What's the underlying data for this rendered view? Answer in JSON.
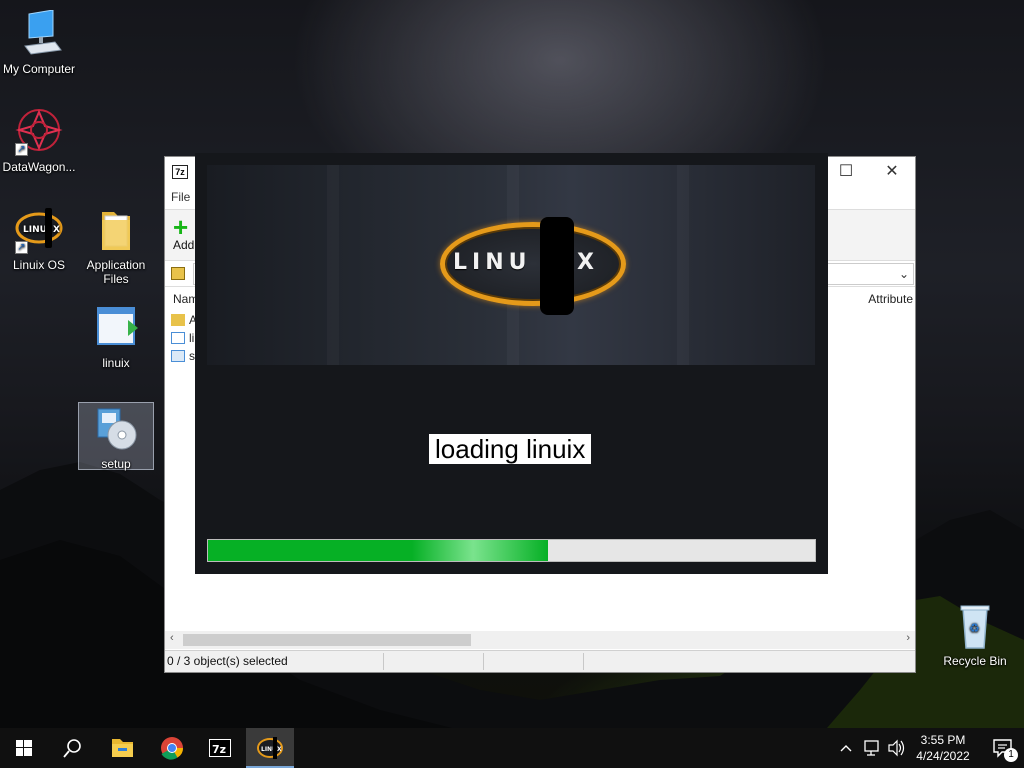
{
  "desktop": {
    "icons": [
      {
        "label": "My Computer",
        "icon": "computer-icon"
      },
      {
        "label": "DataWagon...",
        "icon": "datawagon-icon"
      },
      {
        "label": "Linuix OS",
        "icon": "linuix-os-icon"
      },
      {
        "label": "Application Files",
        "icon": "folder-icon"
      },
      {
        "label": "linuix",
        "icon": "app-window-icon"
      },
      {
        "label": "setup",
        "icon": "setup-cd-icon"
      },
      {
        "label": "Recycle Bin",
        "icon": "recycle-bin-icon"
      }
    ]
  },
  "sevenzip": {
    "app_icon_text": "7z",
    "menu_file": "File",
    "add_label": "Add",
    "column_name": "Nam",
    "column_attributes": "Attribute",
    "rows": [
      {
        "name": "A",
        "icon": "folder-icon"
      },
      {
        "name": "li",
        "icon": "app-window-icon"
      },
      {
        "name": "se",
        "icon": "file-icon"
      }
    ],
    "status_text": "0 / 3 object(s) selected"
  },
  "splash": {
    "logo_text": "LINU",
    "logo_x": "X",
    "loading_text": "loading linuix",
    "progress": 0.56
  },
  "taskbar": {
    "items": [
      "start-icon",
      "search-icon",
      "file-explorer-icon",
      "chrome-icon",
      "7zip-icon",
      "linuix-icon"
    ],
    "clock_time": "3:55 PM",
    "clock_date": "4/24/2022",
    "notification_count": "1"
  }
}
